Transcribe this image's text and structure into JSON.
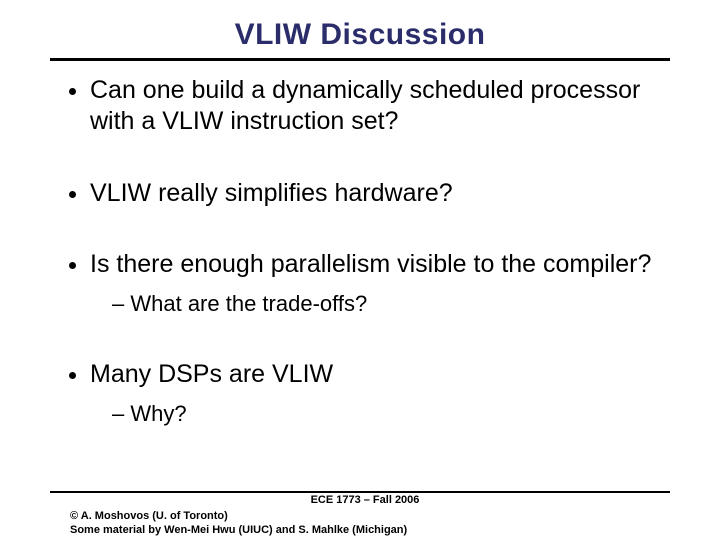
{
  "title": "VLIW Discussion",
  "bullets": [
    {
      "text": "Can one build a dynamically scheduled processor with a VLIW instruction set?",
      "sub": []
    },
    {
      "text": "VLIW really simplifies hardware?",
      "sub": []
    },
    {
      "text": "Is there enough parallelism visible to the compiler?",
      "sub": [
        "What are the trade-offs?"
      ]
    },
    {
      "text": "Many DSPs are VLIW",
      "sub": [
        "Why?"
      ]
    }
  ],
  "footer": {
    "course": "ECE 1773 – Fall 2006",
    "line1": "© A. Moshovos (U. of Toronto)",
    "line2": "Some material by Wen-Mei Hwu (UIUC) and S. Mahlke (Michigan)"
  }
}
